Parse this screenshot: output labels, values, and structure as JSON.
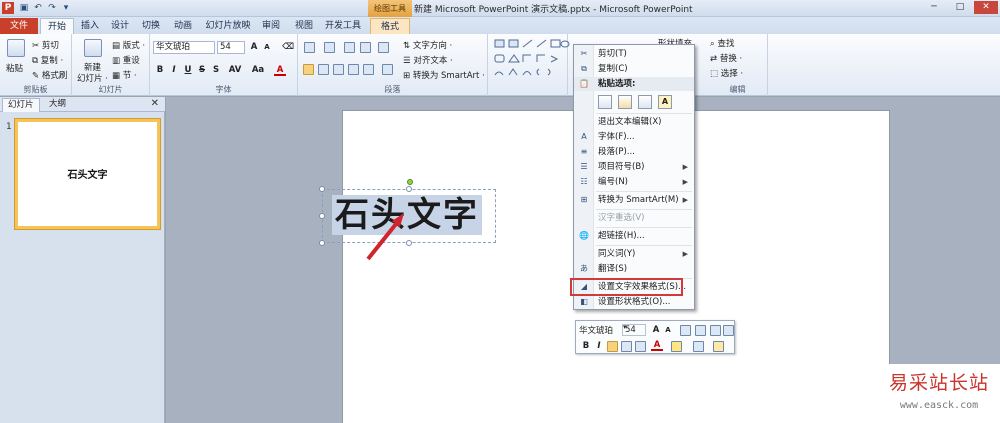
{
  "titlebar": {
    "contextual_tab_group": "绘图工具",
    "window_title": "新建 Microsoft PowerPoint 演示文稿.pptx - Microsoft PowerPoint",
    "minimize": "─",
    "maximize": "□",
    "close": "✕"
  },
  "tabs": [
    "文件",
    "开始",
    "插入",
    "设计",
    "切换",
    "动画",
    "幻灯片放映",
    "审阅",
    "视图",
    "开发工具",
    "格式"
  ],
  "ribbon": {
    "clipboard": {
      "paste": "粘贴",
      "cut": "剪切",
      "copy": "复制 ·",
      "format_painter": "格式刷",
      "label": "剪贴板"
    },
    "slides": {
      "new_slide_1": "新建",
      "new_slide_2": "幻灯片 ·",
      "layout": "版式 ·",
      "reset": "重设",
      "section": "节 ·",
      "label": "幻灯片"
    },
    "font": {
      "font_name": "华文琥珀",
      "font_size": "54",
      "label": "字体"
    },
    "paragraph": {
      "text_direction": "文字方向 ·",
      "align_text": "对齐文本 ·",
      "smartart": "转换为 SmartArt ·",
      "label": "段落"
    },
    "drawing": {
      "shape_fill": "形状填充",
      "find": "查找",
      "replace": "替换 ·",
      "select": "选择 ·",
      "label": "编辑"
    }
  },
  "left_pane": {
    "tab_slides": "幻灯片",
    "tab_outline": "大纲",
    "close": "✕",
    "slide_number": "1",
    "thumbnail_text": "石头文字"
  },
  "slide": {
    "selected_text": "石头文字"
  },
  "context_menu": {
    "items": [
      {
        "label": "剪切(T)",
        "icon": "scissors-icon"
      },
      {
        "label": "复制(C)",
        "icon": "copy-icon"
      },
      {
        "label": "粘贴选项:",
        "icon": "paste-icon"
      },
      {
        "label": "退出文本编辑(X)"
      },
      {
        "label": "字体(F)...",
        "icon": "font-icon"
      },
      {
        "label": "段落(P)...",
        "icon": "paragraph-icon"
      },
      {
        "label": "项目符号(B)",
        "icon": "bullets-icon"
      },
      {
        "label": "编号(N)",
        "icon": "numbering-icon"
      },
      {
        "label": "转换为 SmartArt(M)",
        "icon": "smartart-icon"
      },
      {
        "label": "汉字重选(V)"
      },
      {
        "label": "超链接(H)...",
        "icon": "hyperlink-icon"
      },
      {
        "label": "同义词(Y)"
      },
      {
        "label": "翻译(S)",
        "icon": "translate-icon"
      },
      {
        "label": "设置文字效果格式(S)...",
        "icon": "text-effects-icon"
      },
      {
        "label": "设置形状格式(O)...",
        "icon": "shape-format-icon"
      }
    ],
    "paste_options": [
      "",
      "",
      "",
      "A"
    ]
  },
  "mini_toolbar": {
    "font_name": "华文琥珀",
    "font_size": "54",
    "bold": "B",
    "italic": "I"
  },
  "watermark": {
    "title": "易采站长站",
    "url": "www.easck.com"
  },
  "colors": {
    "file_tab": "#c8402a",
    "contextual_tab": "#e5a23f",
    "highlight_box": "#d23a3a"
  }
}
